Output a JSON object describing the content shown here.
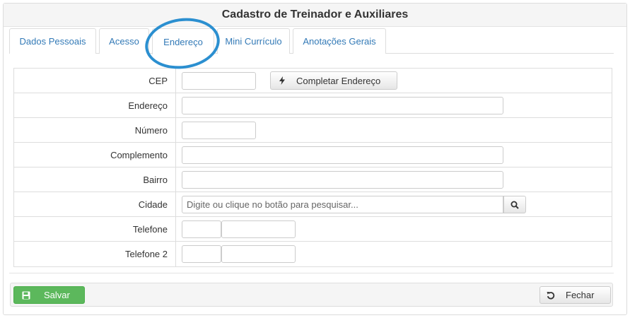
{
  "window": {
    "title": "Cadastro de Treinador e Auxiliares"
  },
  "tabs": [
    {
      "label": "Dados Pessoais"
    },
    {
      "label": "Acesso"
    },
    {
      "label": "Endereço",
      "active": true
    },
    {
      "label": "Mini Currículo"
    },
    {
      "label": "Anotações Gerais"
    }
  ],
  "form": {
    "cep": {
      "label": "CEP",
      "value": ""
    },
    "complete_button": {
      "label": "Completar Endereço",
      "icon": "bolt-icon"
    },
    "endereco": {
      "label": "Endereço",
      "value": ""
    },
    "numero": {
      "label": "Número",
      "value": ""
    },
    "complemento": {
      "label": "Complemento",
      "value": ""
    },
    "bairro": {
      "label": "Bairro",
      "value": ""
    },
    "cidade": {
      "label": "Cidade",
      "value": "",
      "placeholder": "Digite ou clique no botão para pesquisar...",
      "search_icon": "search-icon"
    },
    "telefone": {
      "label": "Telefone",
      "ddd": "",
      "number": ""
    },
    "telefone2": {
      "label": "Telefone 2",
      "ddd": "",
      "number": ""
    }
  },
  "footer": {
    "save_label": "Salvar",
    "save_icon": "floppy-disk-icon",
    "close_label": "Fechar",
    "close_icon": "undo-icon"
  },
  "colors": {
    "accent": "#337ab7",
    "highlight_circle": "#2b8fd0",
    "save_button": "#5cb85c"
  }
}
